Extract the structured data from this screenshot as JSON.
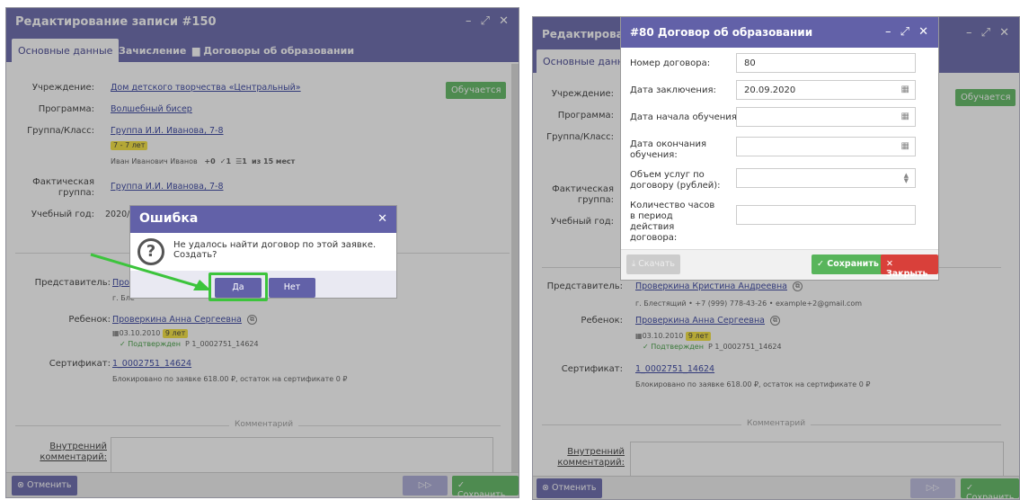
{
  "left": {
    "title": "Редактирование записи #150",
    "tabs": [
      "Основные данные",
      "Зачисление",
      "Договоры об образовании"
    ],
    "labels": {
      "institution": "Учреждение:",
      "program": "Программа:",
      "group": "Группа/Класс:",
      "actual_group": "Фактическая группа:",
      "year": "Учебный год:",
      "representative": "Представитель:",
      "child": "Ребенок:",
      "certificate": "Сертификат:",
      "internal_comment": "Внутренний комментарий:"
    },
    "values": {
      "institution": "Дом детского творчества «Центральный»",
      "program": "Волшебный бисер",
      "group": "Группа И.И. Иванова, 7-8",
      "group_age": "7 - 7 лет",
      "teacher": "Иван Иванович Иванов",
      "seats_plus": "+0",
      "seats_check": "✓1",
      "seats_people": "1",
      "seats_total": "из 15 мест",
      "actual_group": "Группа И.И. Иванова, 7-8",
      "year": "2020/2",
      "representative": "Про",
      "representative_sub": "г. Бле",
      "child": "Проверкина Анна Сергеевна",
      "child_birth": "03.10.2010",
      "child_age": "9 лет",
      "child_confirmed": "✓ Подтвержден",
      "child_cert": "Р 1_0002751_14624",
      "certificate": "1_0002751_14624",
      "cert_note": "Блокировано по заявке 618.00 ₽, остаток на сертификате 0 ₽",
      "comment_section": "Комментарий"
    },
    "status": "Обучается",
    "footer": {
      "cancel": "Отменить",
      "save": "Сохранить"
    },
    "error_dialog": {
      "title": "Ошибка",
      "message": "Не удалось найти договор по этой заявке. Создать?",
      "yes": "Да",
      "no": "Нет"
    }
  },
  "right": {
    "title": "Редактирован",
    "tab": "Основные данные",
    "labels": {
      "institution": "Учреждение:",
      "program": "Программа:",
      "group": "Группа/Класс:",
      "actual_group": "Фактическая группа:",
      "year": "Учебный год:",
      "representative": "Представитель:",
      "child": "Ребенок:",
      "certificate": "Сертификат:",
      "internal_comment": "Внутренний комментарий:"
    },
    "values": {
      "representative": "Проверкина Кристина Андреевна",
      "representative_sub": "г. Блестящий • +7 (999) 778-43-26 • example+2@gmail.com",
      "child": "Проверкина Анна Сергеевна",
      "child_birth": "03.10.2010",
      "child_age": "9 лет",
      "child_confirmed": "✓ Подтвержден",
      "child_cert": "Р 1_0002751_14624",
      "certificate": "1_0002751_14624",
      "cert_note": "Блокировано по заявке 618.00 ₽, остаток на сертификате 0 ₽",
      "comment_section": "Комментарий"
    },
    "status": "Обучается",
    "footer": {
      "cancel": "Отменить",
      "save": "Сохранить"
    },
    "contract_dialog": {
      "title": "#80 Договор об образовании",
      "fields": {
        "number_label": "Номер договора:",
        "number_value": "80",
        "date_label": "Дата заключения:",
        "date_value": "20.09.2020",
        "start_label": "Дата начала обучения:",
        "end_label": "Дата окончания обучения:",
        "amount_label": "Объем услуг по договору (рублей):",
        "hours_label": "Количество часов в период действия договора:"
      },
      "download": "Скачать",
      "save": "Сохранить",
      "close": "Закрыть"
    }
  },
  "colors": {
    "header": "#6261a8",
    "green": "#58b55b",
    "red": "#d9403a",
    "arrow": "#3cc43c"
  }
}
